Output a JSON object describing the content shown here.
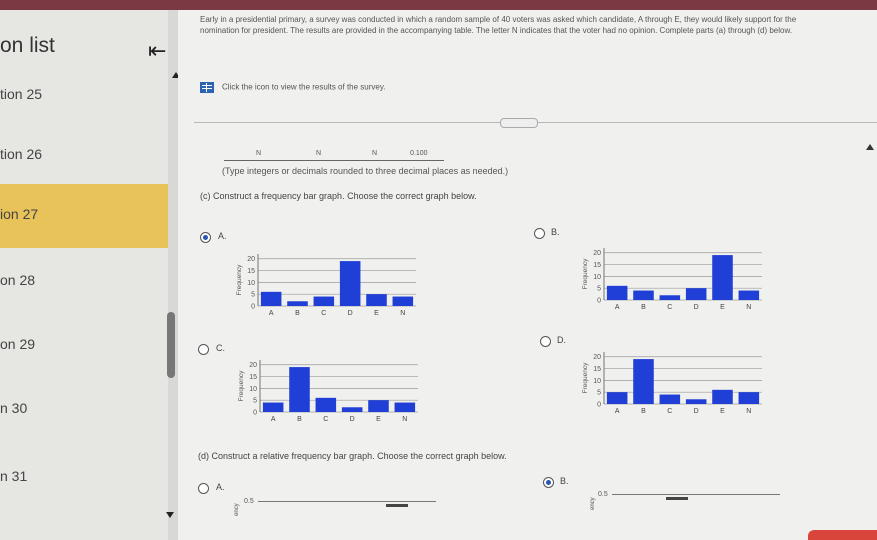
{
  "sidebar": {
    "title": "on list",
    "items": [
      {
        "label": "tion 25",
        "active": false
      },
      {
        "label": "tion 26",
        "active": false
      },
      {
        "label": "ion 27",
        "active": true
      },
      {
        "label": "on 28",
        "active": false
      },
      {
        "label": "on 29",
        "active": false
      },
      {
        "label": "n 30",
        "active": false
      },
      {
        "label": "n 31",
        "active": false
      }
    ]
  },
  "problem": {
    "text": "Early in a presidential primary, a survey was conducted in which a random sample of 40 voters was asked which candidate, A through E, they would likely support for the nomination for president. The results are provided in the accompanying table. The letter N indicates that the voter had no opinion. Complete parts (a) through (d) below.",
    "icon_text": "Click the icon to view the results of the survey."
  },
  "answers": {
    "partial_values": [
      "N",
      "N",
      "N",
      "0.100"
    ],
    "hint": "(Type integers or decimals rounded to three decimal places as needed.)"
  },
  "part_c": {
    "question": "(c) Construct a frequency bar graph. Choose the correct graph below.",
    "options": [
      {
        "letter": "A.",
        "selected": true
      },
      {
        "letter": "B.",
        "selected": false
      },
      {
        "letter": "C.",
        "selected": false
      },
      {
        "letter": "D.",
        "selected": false
      }
    ]
  },
  "part_d": {
    "question": "(d) Construct a relative frequency bar graph. Choose the correct graph below.",
    "options": [
      {
        "letter": "A.",
        "selected": false,
        "ylabel": "ency",
        "tick": "0.5"
      },
      {
        "letter": "B.",
        "selected": true,
        "ylabel": "ency",
        "tick": "0.5"
      }
    ]
  },
  "colors": {
    "bar": "#1f3fd6",
    "accent_active": "#e8c35a",
    "radio_selected": "#2a55b0",
    "topbar": "#7a3a44",
    "bottom_button": "#d9453a"
  },
  "icons": {
    "collapse": "collapse-left-icon",
    "table": "table-grid-icon"
  },
  "chart_data": [
    {
      "type": "bar",
      "option": "A",
      "categories": [
        "A",
        "B",
        "C",
        "D",
        "E",
        "N"
      ],
      "values": [
        6,
        2,
        4,
        19,
        5,
        4
      ],
      "ylabel": "Frequency",
      "yticks": [
        "0",
        "5",
        "10",
        "15",
        "20"
      ],
      "ylim": [
        0,
        22
      ]
    },
    {
      "type": "bar",
      "option": "B",
      "categories": [
        "A",
        "B",
        "C",
        "D",
        "E",
        "N"
      ],
      "values": [
        6,
        4,
        2,
        5,
        19,
        4
      ],
      "ylabel": "Frequency",
      "yticks": [
        "0",
        "5",
        "10",
        "15",
        "20"
      ],
      "ylim": [
        0,
        22
      ]
    },
    {
      "type": "bar",
      "option": "C",
      "categories": [
        "A",
        "B",
        "C",
        "D",
        "E",
        "N"
      ],
      "values": [
        4,
        19,
        6,
        2,
        5,
        4
      ],
      "ylabel": "Frequency",
      "yticks": [
        "0",
        "5",
        "10",
        "15",
        "20"
      ],
      "ylim": [
        0,
        22
      ]
    },
    {
      "type": "bar",
      "option": "D",
      "categories": [
        "A",
        "B",
        "C",
        "D",
        "E",
        "N"
      ],
      "values": [
        5,
        19,
        4,
        2,
        6,
        5
      ],
      "ylabel": "Frequency",
      "yticks": [
        "0",
        "5",
        "10",
        "15",
        "20"
      ],
      "ylim": [
        0,
        22
      ]
    }
  ]
}
